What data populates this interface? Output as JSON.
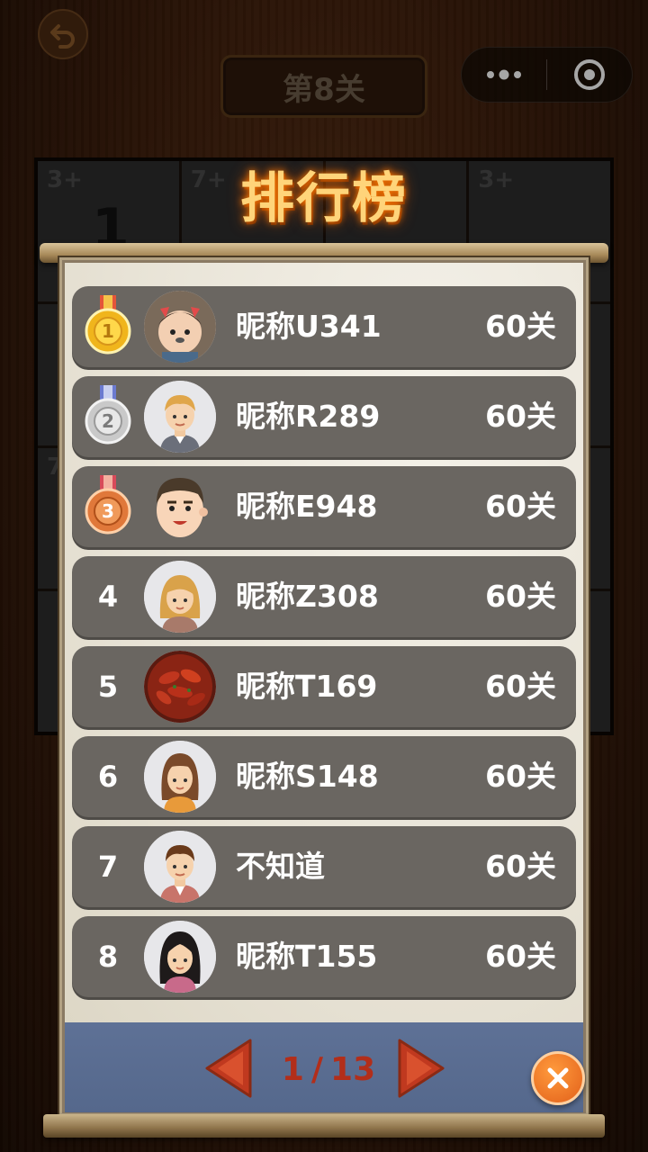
{
  "header": {
    "level_label": "第8关"
  },
  "grid": {
    "cells": [
      {
        "clue": "3+",
        "value": "1"
      },
      {
        "clue": "7+",
        "value": ""
      },
      {
        "clue": "",
        "value": ""
      },
      {
        "clue": "3+",
        "value": ""
      },
      {
        "clue": "",
        "value": ""
      },
      {
        "clue": "",
        "value": ""
      },
      {
        "clue": "",
        "value": ""
      },
      {
        "clue": "",
        "value": ""
      },
      {
        "clue": "7",
        "value": ""
      },
      {
        "clue": "",
        "value": ""
      },
      {
        "clue": "",
        "value": ""
      },
      {
        "clue": "",
        "value": ""
      },
      {
        "clue": "",
        "value": ""
      },
      {
        "clue": "",
        "value": ""
      },
      {
        "clue": "",
        "value": ""
      },
      {
        "clue": "",
        "value": ""
      }
    ]
  },
  "leaderboard": {
    "title": "排行榜",
    "entries": [
      {
        "rank": "1",
        "medal": "gold",
        "avatar": "child-photo",
        "name": "昵称U341",
        "score": "60关"
      },
      {
        "rank": "2",
        "medal": "silver",
        "avatar": "blond-man",
        "name": "昵称R289",
        "score": "60关"
      },
      {
        "rank": "3",
        "medal": "bronze",
        "avatar": "cartoon-man",
        "name": "昵称E948",
        "score": "60关"
      },
      {
        "rank": "4",
        "medal": "",
        "avatar": "blonde-woman",
        "name": "昵称Z308",
        "score": "60关"
      },
      {
        "rank": "5",
        "medal": "",
        "avatar": "crayfish-photo",
        "name": "昵称T169",
        "score": "60关"
      },
      {
        "rank": "6",
        "medal": "",
        "avatar": "brown-hair-woman",
        "name": "昵称S148",
        "score": "60关"
      },
      {
        "rank": "7",
        "medal": "",
        "avatar": "vest-man",
        "name": "不知道",
        "score": "60关"
      },
      {
        "rank": "8",
        "medal": "",
        "avatar": "black-hair-woman",
        "name": "昵称T155",
        "score": "60关"
      }
    ],
    "pagination": {
      "current": "1",
      "separator": "/",
      "total": "13"
    }
  },
  "colors": {
    "row_bg": "#6a6661",
    "paper": "#ece8dc",
    "band": "#5a6d92",
    "pager_red": "#b22e1a",
    "close_orange": "#f0781f",
    "title_gold": "#ffd47a"
  }
}
